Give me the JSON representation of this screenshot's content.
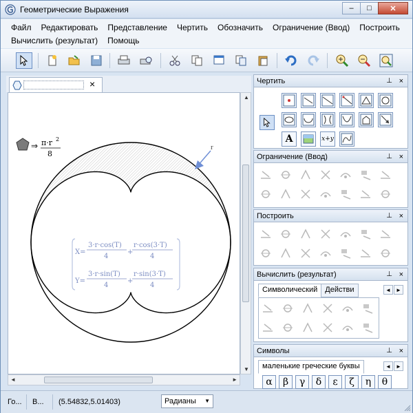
{
  "window": {
    "title": "Геометрические Выражения",
    "buttons": {
      "minimize": "–",
      "maximize": "□",
      "close": "✕"
    }
  },
  "menu": {
    "row1": [
      "Файл",
      "Редактировать",
      "Представление",
      "Чертить",
      "Обозначить",
      "Ограничение (Ввод)",
      "Построить"
    ],
    "row2": [
      "Вычислить (результат)",
      "Помощь"
    ]
  },
  "toolbar": {
    "icons": [
      "select-arrow-icon",
      "new-file-icon",
      "open-folder-icon",
      "save-disk-icon",
      "print-icon",
      "print-preview-icon",
      "cut-scissors-icon",
      "copy-icon",
      "copy-format-icon",
      "copy-drawing-icon",
      "paste-icon",
      "undo-icon",
      "redo-icon",
      "zoom-in-icon",
      "zoom-out-icon",
      "zoom-fit-icon"
    ]
  },
  "document": {
    "tab_close": "×",
    "area_expression": {
      "arrow": "⇒",
      "numerator": "π·r",
      "exponent": "2",
      "denominator": "8"
    },
    "radius_label": "r",
    "parametric": {
      "x_prefix": "X=",
      "x_term1_num": "3·r·cos(T)",
      "x_term1_den": "4",
      "x_op": "+",
      "x_term2_num": "r·cos(3·T)",
      "x_term2_den": "4",
      "y_prefix": "Y=",
      "y_term1_num": "3·r·sin(T)",
      "y_term1_den": "4",
      "y_op": "+",
      "y_term2_num": "r·sin(3·T)",
      "y_term2_den": "4"
    }
  },
  "panels": {
    "draw": {
      "title": "Чертить",
      "pin": "⊥",
      "close": "×",
      "text_icon_label": "A",
      "function_icon_label": "x+y"
    },
    "constrain": {
      "title": "Ограничение (Ввод)",
      "pin": "⊥",
      "close": "×"
    },
    "construct": {
      "title": "Построить",
      "pin": "⊥",
      "close": "×"
    },
    "calculate": {
      "title": "Вычислить (результат)",
      "pin": "⊥",
      "close": "×",
      "tabs": [
        "Символический",
        "Действи"
      ],
      "arrows": [
        "◄",
        "►"
      ]
    },
    "symbols": {
      "title": "Символы",
      "pin": "⊥",
      "close": "×",
      "tab": "маленькие греческие буквы",
      "arrows": [
        "◄",
        "►"
      ],
      "letters": [
        "α",
        "β",
        "γ",
        "δ",
        "ε",
        "ζ",
        "η",
        "θ"
      ]
    }
  },
  "status": {
    "cell1": "Го...",
    "cell2": "В...",
    "coords": "(5.54832,5.01403)",
    "angle_mode": "Радианы"
  }
}
